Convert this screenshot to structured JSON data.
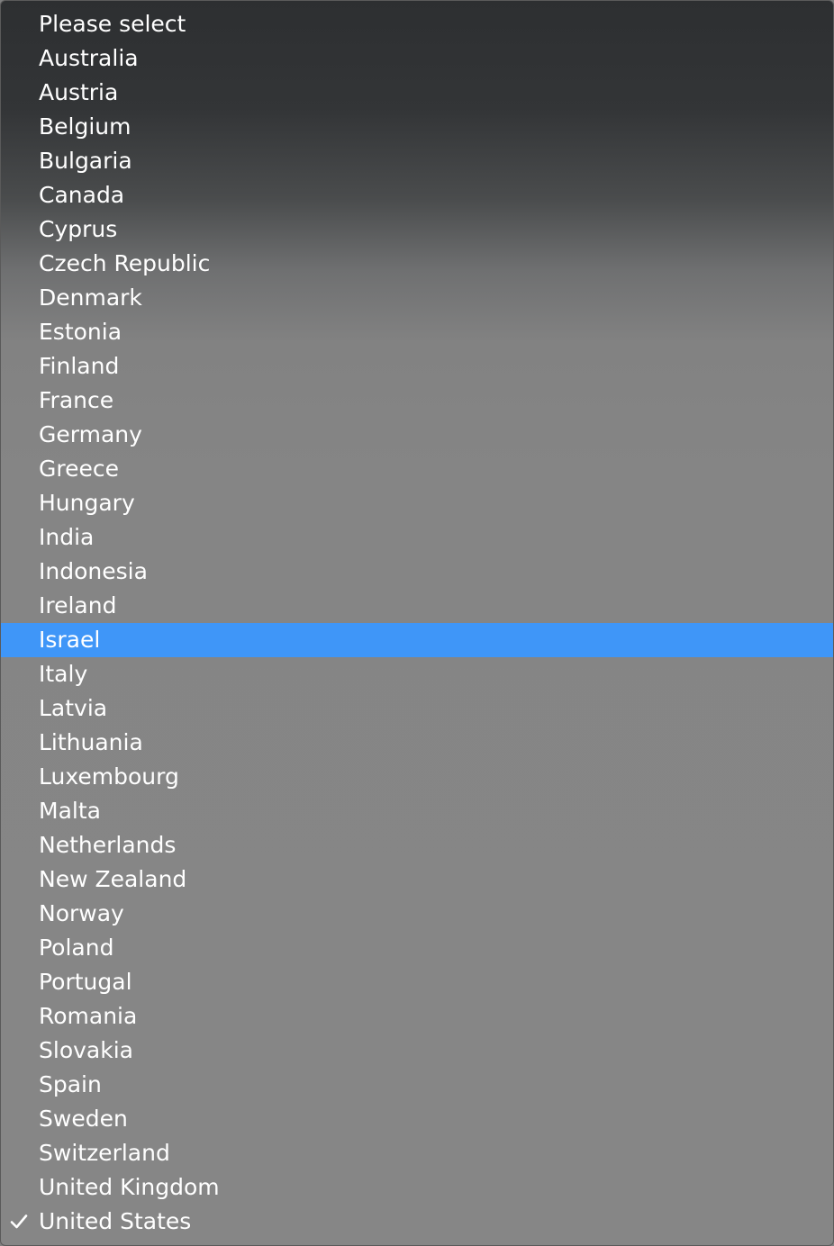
{
  "menu": {
    "highlight_color": "#3f96f8",
    "items": [
      {
        "label": "Please select"
      },
      {
        "label": "Australia"
      },
      {
        "label": "Austria"
      },
      {
        "label": "Belgium"
      },
      {
        "label": "Bulgaria"
      },
      {
        "label": "Canada"
      },
      {
        "label": "Cyprus"
      },
      {
        "label": "Czech Republic"
      },
      {
        "label": "Denmark"
      },
      {
        "label": "Estonia"
      },
      {
        "label": "Finland"
      },
      {
        "label": "France"
      },
      {
        "label": "Germany"
      },
      {
        "label": "Greece"
      },
      {
        "label": "Hungary"
      },
      {
        "label": "India"
      },
      {
        "label": "Indonesia"
      },
      {
        "label": "Ireland"
      },
      {
        "label": "Israel",
        "highlighted": true
      },
      {
        "label": "Italy"
      },
      {
        "label": "Latvia"
      },
      {
        "label": "Lithuania"
      },
      {
        "label": "Luxembourg"
      },
      {
        "label": "Malta"
      },
      {
        "label": "Netherlands"
      },
      {
        "label": "New Zealand"
      },
      {
        "label": "Norway"
      },
      {
        "label": "Poland"
      },
      {
        "label": "Portugal"
      },
      {
        "label": "Romania"
      },
      {
        "label": "Slovakia"
      },
      {
        "label": "Spain"
      },
      {
        "label": "Sweden"
      },
      {
        "label": "Switzerland"
      },
      {
        "label": "United Kingdom"
      },
      {
        "label": "United States",
        "selected": true,
        "icon": "checkmark-icon"
      }
    ]
  }
}
